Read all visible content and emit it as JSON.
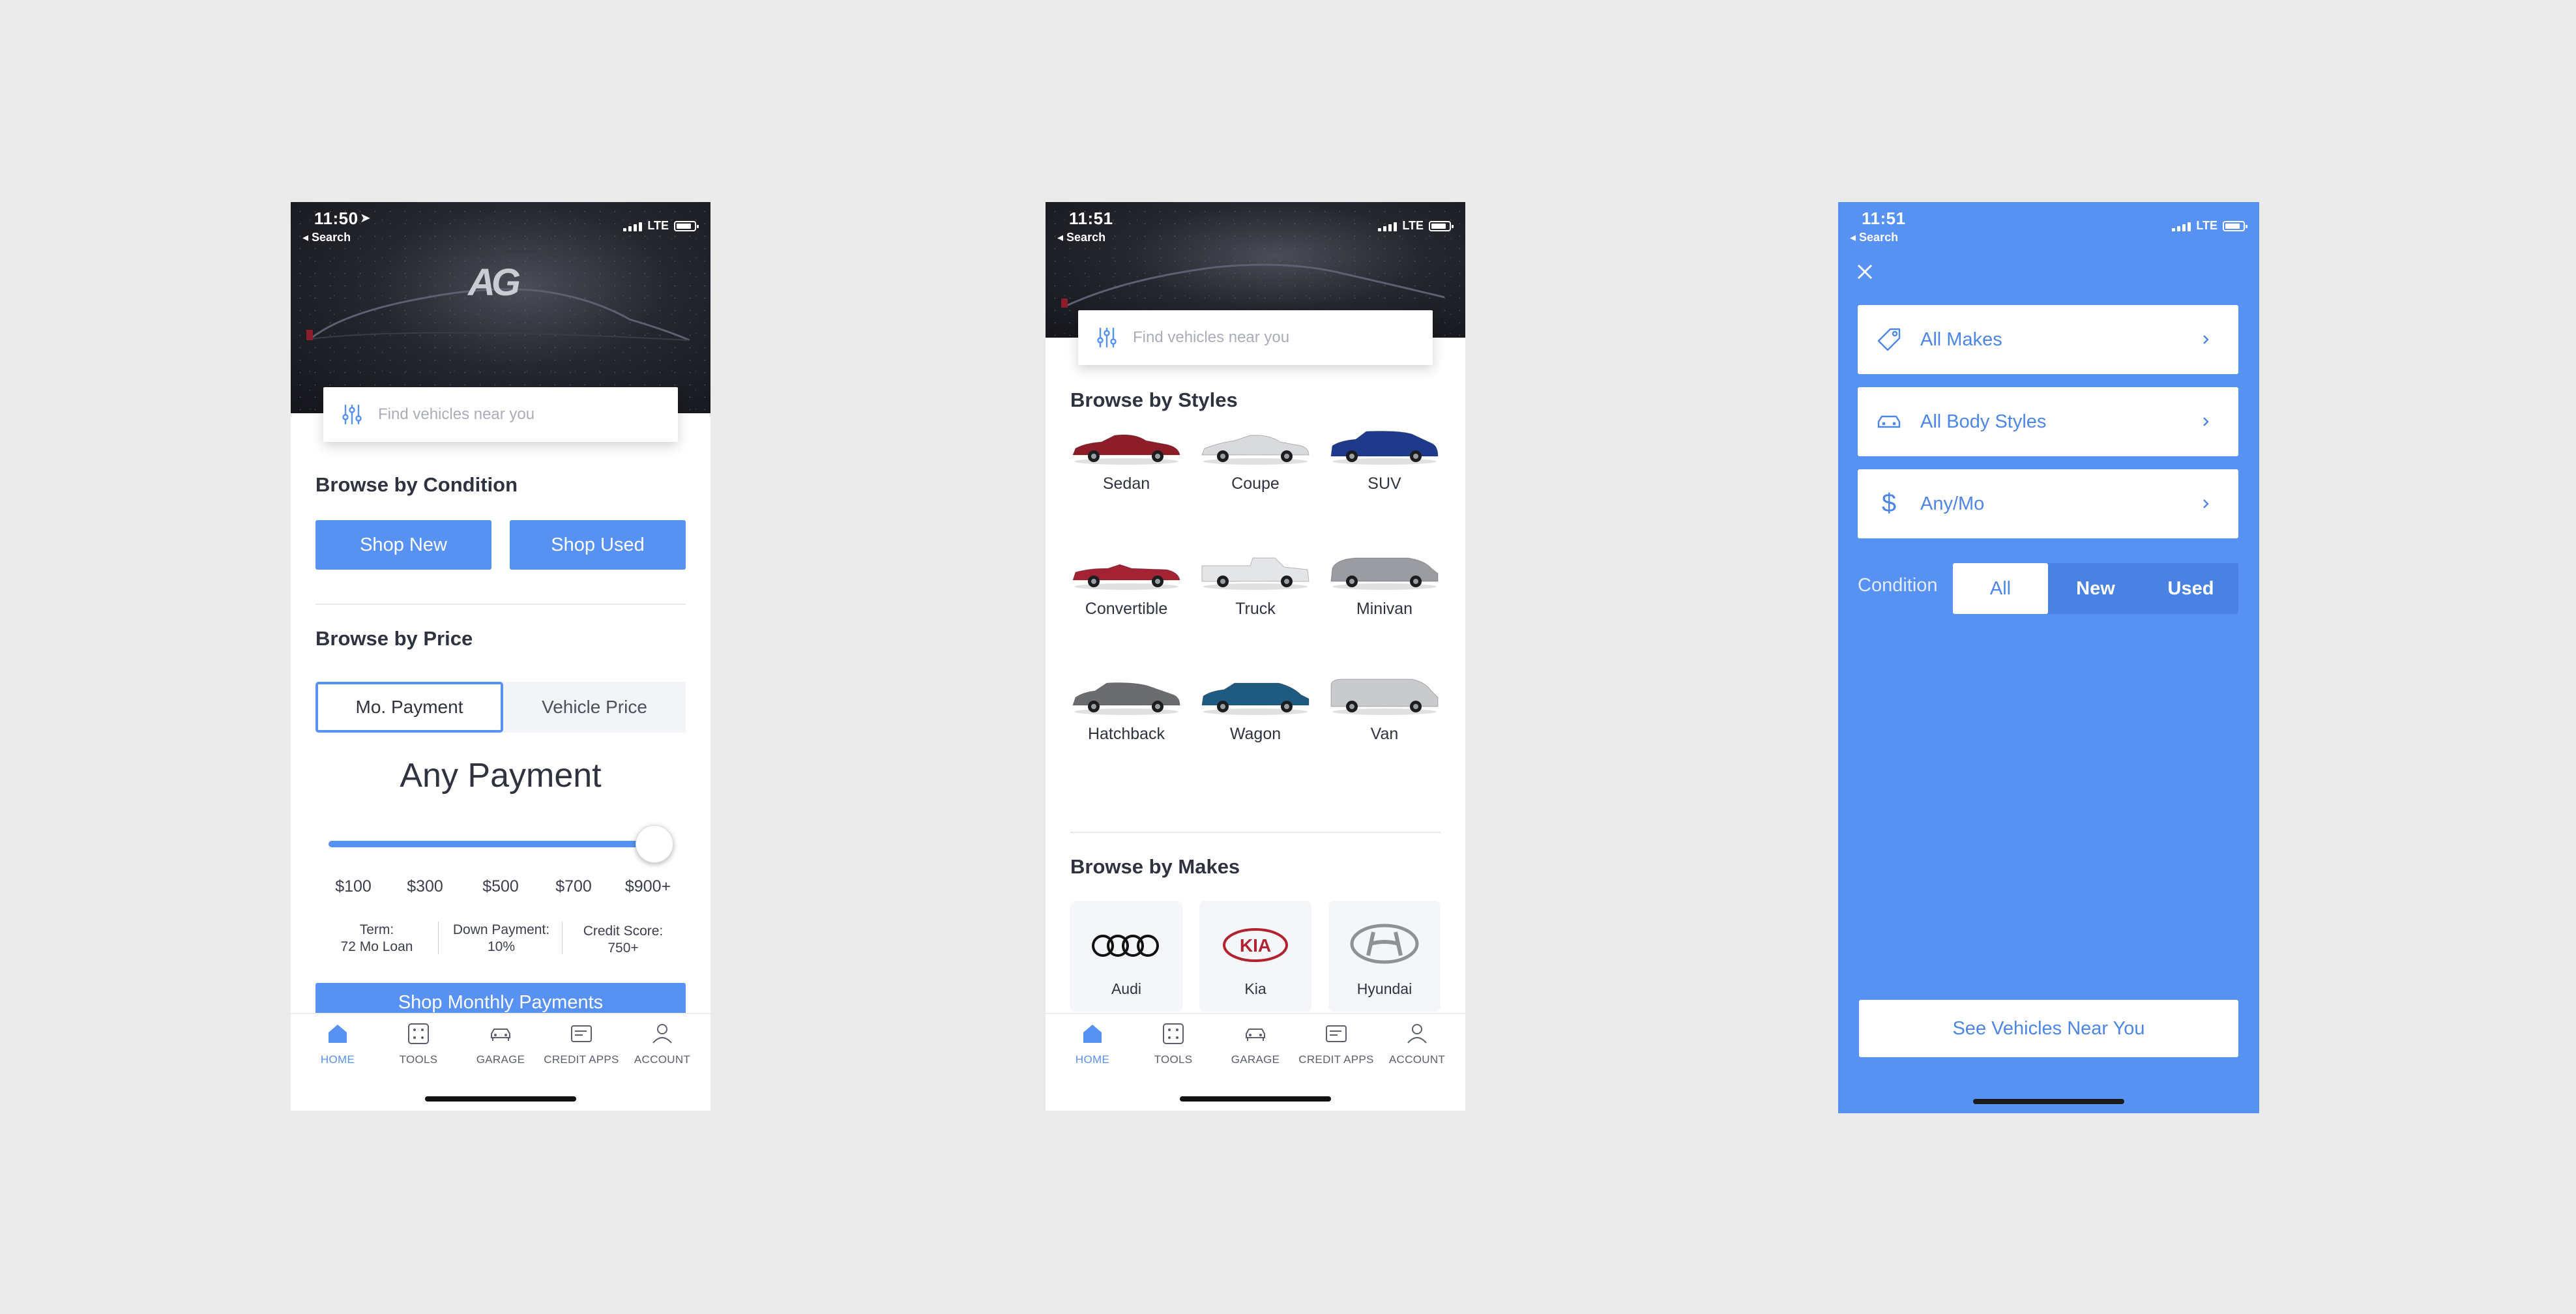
{
  "status_bar": {
    "time_1": "11:50",
    "time_2": "11:51",
    "time_3": "11:51",
    "back_label": "◂ Search",
    "network": "LTE"
  },
  "search": {
    "placeholder": "Find vehicles near you"
  },
  "brand": {
    "logo_text": "AG"
  },
  "home_screen": {
    "condition_title": "Browse by Condition",
    "shop_new": "Shop New",
    "shop_used": "Shop Used",
    "price_title": "Browse by Price",
    "price_tabs": [
      "Mo. Payment",
      "Vehicle Price"
    ],
    "payment_heading": "Any Payment",
    "slider": {
      "ticks": [
        "$100",
        "$300",
        "$500",
        "$700",
        "$900+"
      ],
      "value_fraction": 1.0
    },
    "term_label": "Term:",
    "term_value": "72 Mo Loan",
    "down_label": "Down Payment:",
    "down_value": "10%",
    "credit_label": "Credit Score:",
    "credit_value": "750+",
    "cta": "Shop Monthly Payments"
  },
  "styles_screen": {
    "styles_title": "Browse by Styles",
    "styles": [
      {
        "label": "Sedan",
        "color": "#8e1d2a",
        "shape": "sedan"
      },
      {
        "label": "Coupe",
        "color": "#d9dadd",
        "shape": "coupe"
      },
      {
        "label": "SUV",
        "color": "#1f3a8a",
        "shape": "suv"
      },
      {
        "label": "Convertible",
        "color": "#a32234",
        "shape": "convertible"
      },
      {
        "label": "Truck",
        "color": "#e4e5e8",
        "shape": "truck"
      },
      {
        "label": "Minivan",
        "color": "#9a9ca2",
        "shape": "minivan"
      },
      {
        "label": "Hatchback",
        "color": "#6b6c70",
        "shape": "hatchback"
      },
      {
        "label": "Wagon",
        "color": "#1f5b80",
        "shape": "wagon"
      },
      {
        "label": "Van",
        "color": "#c9cacd",
        "shape": "van"
      }
    ],
    "makes_title": "Browse by Makes",
    "makes": [
      {
        "label": "Audi",
        "icon": "audi-rings-icon"
      },
      {
        "label": "Kia",
        "icon": "kia-logo-icon"
      },
      {
        "label": "Hyundai",
        "icon": "hyundai-logo-icon"
      }
    ]
  },
  "tabbar": {
    "items": [
      {
        "label": "HOME",
        "icon": "home-icon"
      },
      {
        "label": "TOOLS",
        "icon": "tools-icon"
      },
      {
        "label": "GARAGE",
        "icon": "garage-icon"
      },
      {
        "label": "CREDIT APPS",
        "icon": "credit-apps-icon"
      },
      {
        "label": "ACCOUNT",
        "icon": "account-icon"
      }
    ],
    "active_index": 0
  },
  "filter_screen": {
    "rows": [
      {
        "label": "All Makes",
        "icon": "tag-icon"
      },
      {
        "label": "All Body Styles",
        "icon": "car-icon"
      },
      {
        "label": "Any/Mo",
        "icon": "dollar-icon"
      }
    ],
    "condition_label": "Condition",
    "condition_options": [
      "All",
      "New",
      "Used"
    ],
    "condition_selected": "All",
    "cta": "See Vehicles Near You"
  },
  "colors": {
    "accent": "#5791f2",
    "text": "#2f3340",
    "panel": "#5791f2"
  }
}
